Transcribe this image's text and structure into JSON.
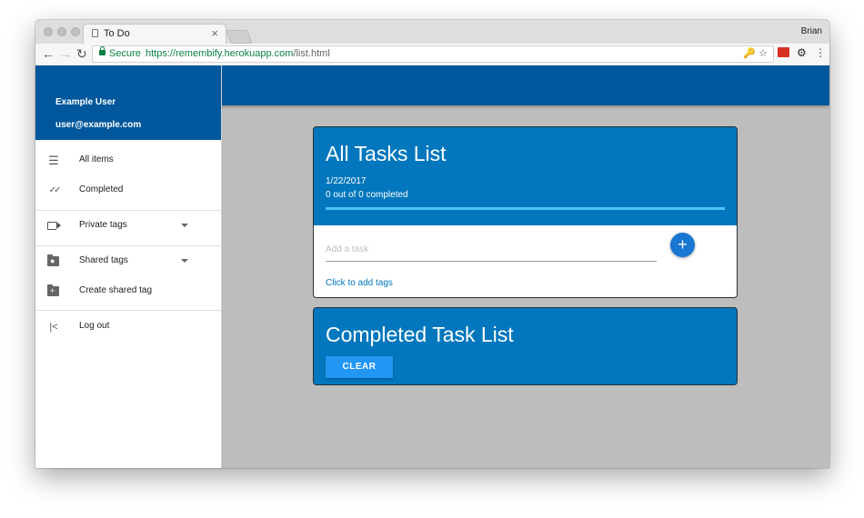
{
  "browser": {
    "tab_title": "To Do",
    "tab_close": "×",
    "profile_name": "Brian",
    "secure_label": "Secure",
    "url_base": "https://remembify.herokuapp.com",
    "url_path": "/list.html",
    "back": "←",
    "forward": "→",
    "reload": "↻",
    "omnibox_icons": "🔑 ☆",
    "gear": "⚙",
    "menu": "⋮"
  },
  "user": {
    "name": "Example User",
    "email": "user@example.com"
  },
  "sidebar": {
    "items": [
      {
        "label": "All items",
        "icon": "list-icon",
        "glyph": "☰"
      },
      {
        "label": "Completed",
        "icon": "done-all-icon",
        "glyph": "✓✓"
      },
      {
        "label": "Private tags",
        "icon": "tag-icon"
      },
      {
        "label": "Shared tags",
        "icon": "shared-folder-icon"
      },
      {
        "label": "Create shared tag",
        "icon": "add-folder-icon"
      },
      {
        "label": "Log out",
        "icon": "logout-icon",
        "glyph": "|<"
      }
    ]
  },
  "all_tasks": {
    "title": "All Tasks List",
    "date": "1/22/2017",
    "progress_text": "0 out of 0 completed",
    "progress_fraction": 1.0,
    "input_placeholder": "Add a task",
    "add_button": "+",
    "add_tags_link": "Click to add tags"
  },
  "completed_tasks": {
    "title": "Completed Task List",
    "clear_button": "CLEAR"
  },
  "colors": {
    "primary_dark": "#01579b",
    "card_blue": "#0277bd",
    "accent": "#2196f3",
    "background": "#bdbdbd"
  }
}
